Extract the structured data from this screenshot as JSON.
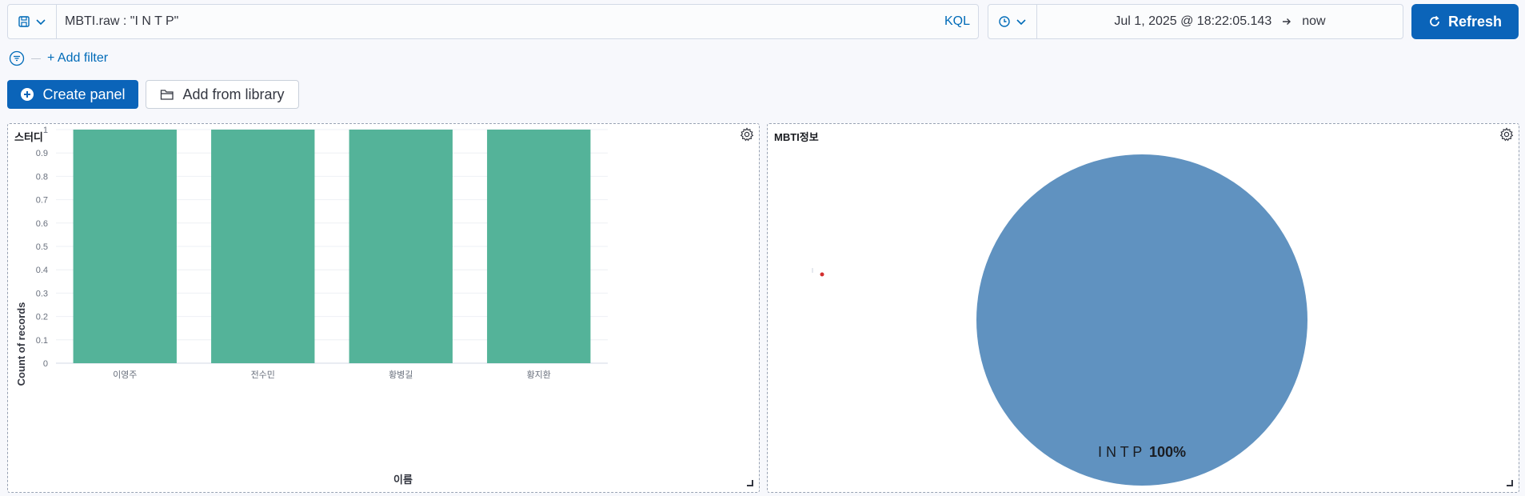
{
  "query": {
    "text": "MBTI.raw : \"I N T P\"",
    "language_label": "KQL"
  },
  "time": {
    "start": "Jul 1, 2025 @ 18:22:05.143",
    "end": "now"
  },
  "refresh_label": "Refresh",
  "filter": {
    "add_label": "+ Add filter"
  },
  "toolbar": {
    "create_panel_label": "Create panel",
    "add_library_label": "Add from library"
  },
  "panels": [
    {
      "title": "스터디",
      "chart_data": {
        "type": "bar",
        "categories": [
          "이영주",
          "전수민",
          "황병길",
          "황지환"
        ],
        "values": [
          1,
          1,
          1,
          1
        ],
        "xlabel": "이름",
        "ylabel": "Count of records",
        "ylim": [
          0,
          1
        ],
        "yticks": [
          "0",
          "0.1",
          "0.2",
          "0.3",
          "0.4",
          "0.5",
          "0.6",
          "0.7",
          "0.8",
          "0.9",
          "1"
        ],
        "color": "#54b399"
      }
    },
    {
      "title": "MBTI정보",
      "chart_data": {
        "type": "pie",
        "slices": [
          {
            "label": "I N T P",
            "value": 100,
            "display": "100%"
          }
        ],
        "color": "#6092c0"
      }
    }
  ],
  "colors": {
    "primary": "#0b64b9",
    "link": "#006bb8",
    "bar": "#54b399",
    "pie": "#6092c0"
  },
  "icons": [
    "save-icon",
    "chevron-down-icon",
    "clock-icon",
    "refresh-icon",
    "filter-icon",
    "plus-circle-icon",
    "folder-icon",
    "gear-icon",
    "resize-icon"
  ]
}
